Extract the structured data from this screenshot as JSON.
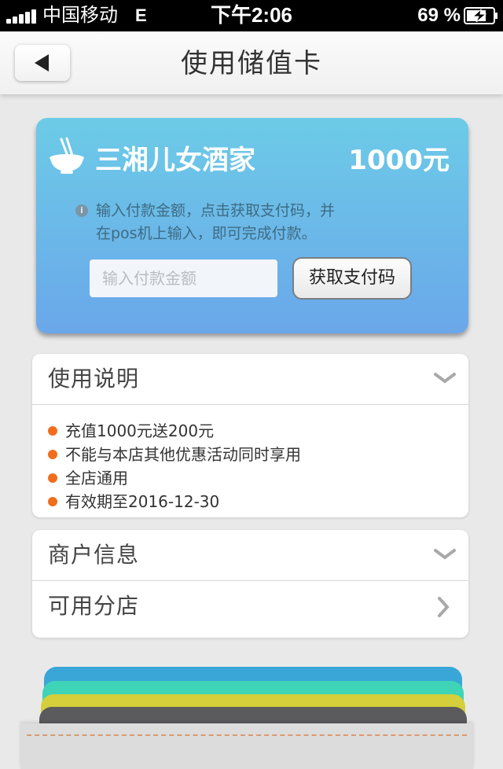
{
  "status_bar": {
    "carrier": "中国移动",
    "network": "E",
    "time": "下午2:06",
    "battery": "69 %"
  },
  "nav": {
    "title": "使用储值卡"
  },
  "card": {
    "shop_name": "三湘儿女酒家",
    "amount": "1000元",
    "hint_line1": "输入付款金额，点击获取支付码，并",
    "hint_line2": "在pos机上输入，即可完成付款。",
    "input_placeholder": "输入付款金额",
    "input_value": "",
    "button_label": "获取支付码",
    "icon": "bowl-chopsticks-icon"
  },
  "usage": {
    "header": "使用说明",
    "rules": [
      "充值1000元送200元",
      "不能与本店其他优惠活动同时享用",
      "全店通用",
      "有效期至2016-12-30"
    ]
  },
  "merchant": {
    "info_label": "商户信息",
    "branches_label": "可用分店"
  },
  "colors": {
    "card_top": "#6ccbe7",
    "card_bottom": "#6aa7ea",
    "bullet": "#f06d1e",
    "stack": [
      "#3aa6d7",
      "#3fd3b8",
      "#d4cf3a",
      "#5b5b5d"
    ]
  }
}
